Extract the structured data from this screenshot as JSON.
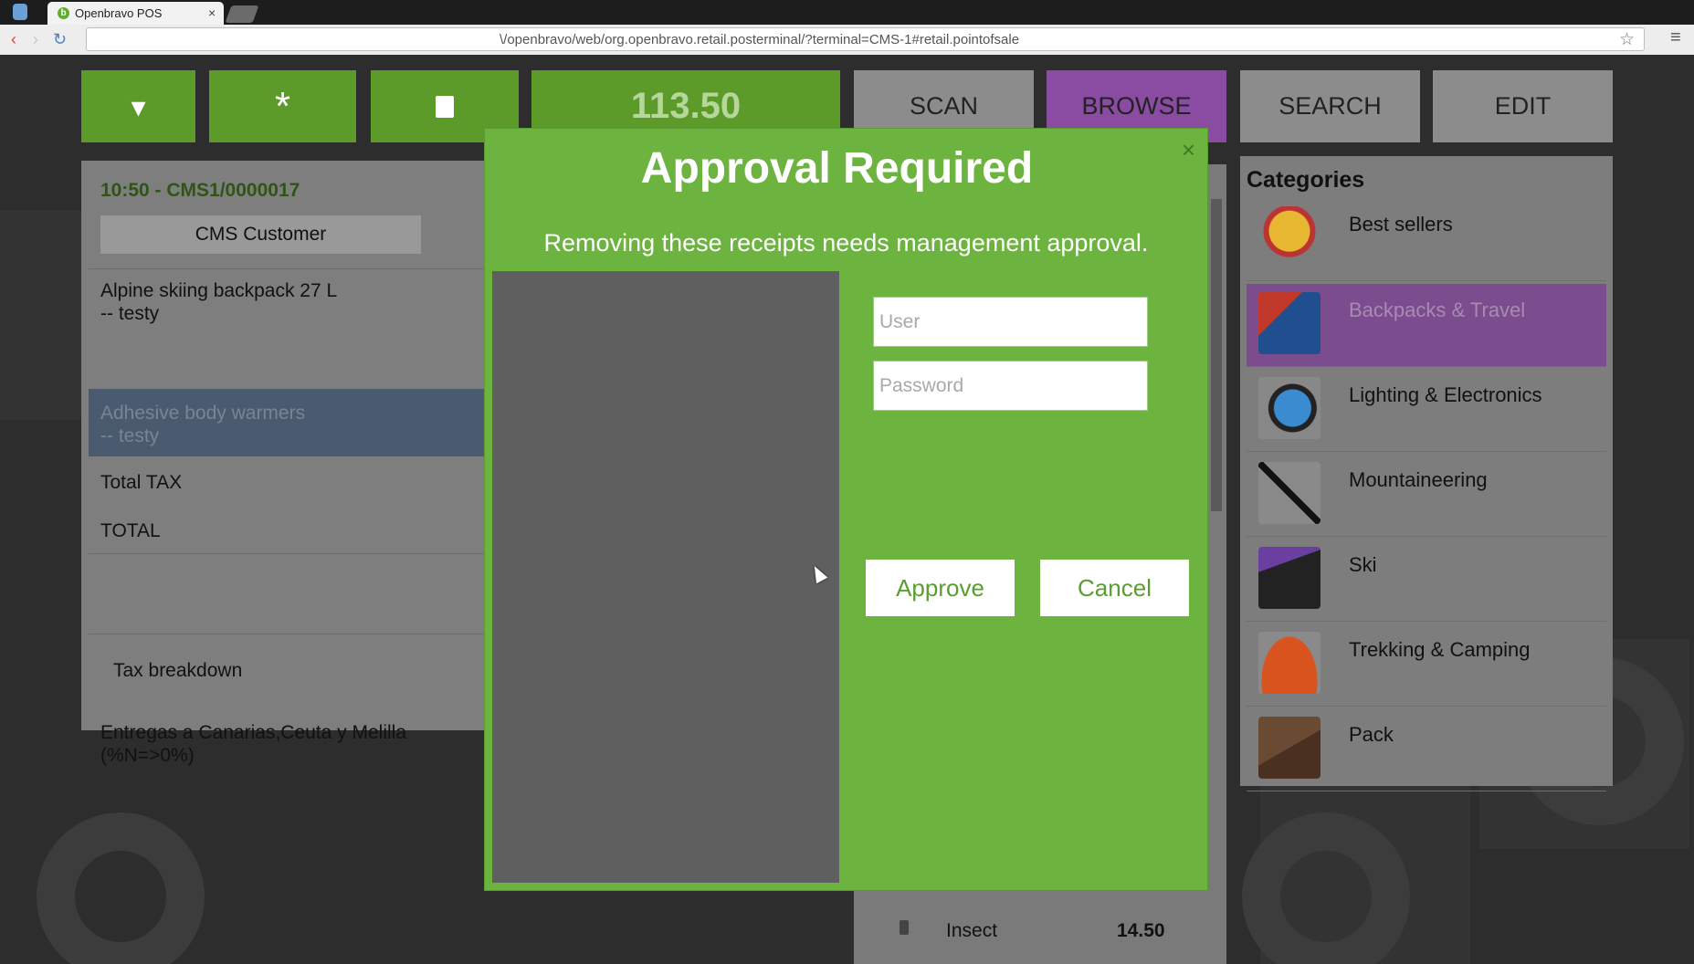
{
  "browser": {
    "tab_title": "Openbravo POS",
    "tab_close": "×",
    "url": "\\/openbravo/web/org.openbravo.retail.posterminal/?terminal=CMS-1#retail.pointofsale",
    "back_glyph": "‹",
    "forward_glyph": "›",
    "reload_glyph": "↻",
    "star_glyph": "☆",
    "menu_glyph": "≡"
  },
  "toolbar": {
    "menu_glyph": "▾",
    "asterisk_glyph": "*",
    "trash_glyph": "🗑",
    "total": "113.50",
    "tabs": [
      "SCAN",
      "BROWSE",
      "SEARCH",
      "EDIT"
    ],
    "active_tab": "BROWSE"
  },
  "receipt": {
    "header": "10:50 - CMS1/0000017",
    "customer": "CMS Customer",
    "lines": [
      {
        "name": "Alpine skiing backpack 27 L",
        "note": "-- testy"
      },
      {
        "name": "Adhesive body warmers",
        "note": "-- testy",
        "selected": true
      }
    ],
    "total_tax_label": "Total TAX",
    "total_label": "TOTAL",
    "tax_breakdown_label": "Tax breakdown",
    "tax_line_1": "Entregas a Canarias,Ceuta y Melilla",
    "tax_line_2": "(%N=>0%)"
  },
  "product_list": {
    "visible_row": {
      "name": "Insect",
      "price": "14.50"
    }
  },
  "categories": {
    "title": "Categories",
    "items": [
      {
        "label": "Best sellers",
        "icon": "medal-icon"
      },
      {
        "label": "Backpacks & Travel",
        "icon": "backpack-icon",
        "selected": true
      },
      {
        "label": "Lighting & Electronics",
        "icon": "flashlight-icon"
      },
      {
        "label": "Mountaineering",
        "icon": "ice-axe-icon"
      },
      {
        "label": "Ski",
        "icon": "ski-boot-icon"
      },
      {
        "label": "Trekking & Camping",
        "icon": "tent-icon"
      },
      {
        "label": "Pack",
        "icon": "box-icon"
      }
    ]
  },
  "dialog": {
    "title": "Approval Required",
    "message": "Removing these receipts needs management approval.",
    "close_glyph": "×",
    "user_placeholder": "User",
    "password_placeholder": "Password",
    "approve_label": "Approve",
    "cancel_label": "Cancel"
  },
  "colors": {
    "dialog_green": "#6db33f",
    "toolbar_green": "#5c9a2a",
    "browse_purple": "#8a4ba3",
    "selected_category": "#7b4c8e"
  }
}
